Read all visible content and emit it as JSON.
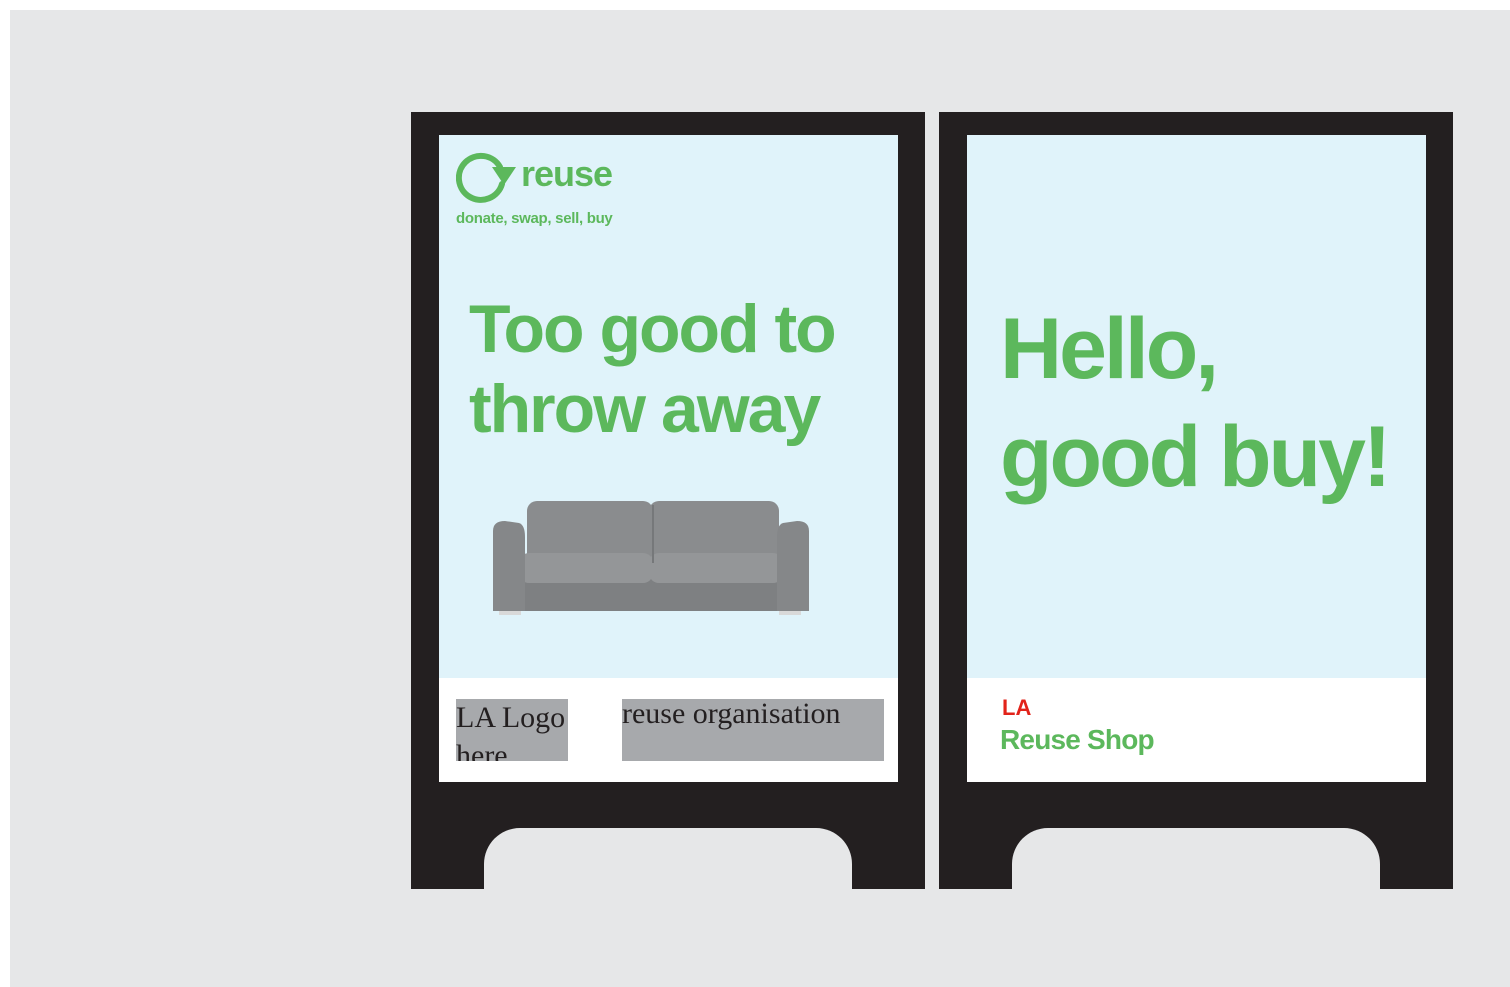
{
  "colors": {
    "background": "#e6e7e8",
    "board": "#231f20",
    "panel": "#e0f3fa",
    "brand_green": "#5cb85c",
    "la_red": "#e2231a",
    "placeholder_gray": "#a7a9ac"
  },
  "left_sign": {
    "logo_icon": "reuse-cycle-arrow-icon",
    "logo_word": "reuse",
    "tagline": "donate, swap, sell, buy",
    "headline_line1": "Too good to",
    "headline_line2": "throw away",
    "image": "sofa",
    "footer": {
      "la_logo_placeholder_line1": "LA Logo",
      "la_logo_placeholder_line2": "here",
      "reuse_org_placeholder": "reuse organisation"
    }
  },
  "right_sign": {
    "headline_line1": "Hello,",
    "headline_line2": "good buy!",
    "footer": {
      "la_label": "LA",
      "shop_label": "Reuse Shop"
    }
  }
}
